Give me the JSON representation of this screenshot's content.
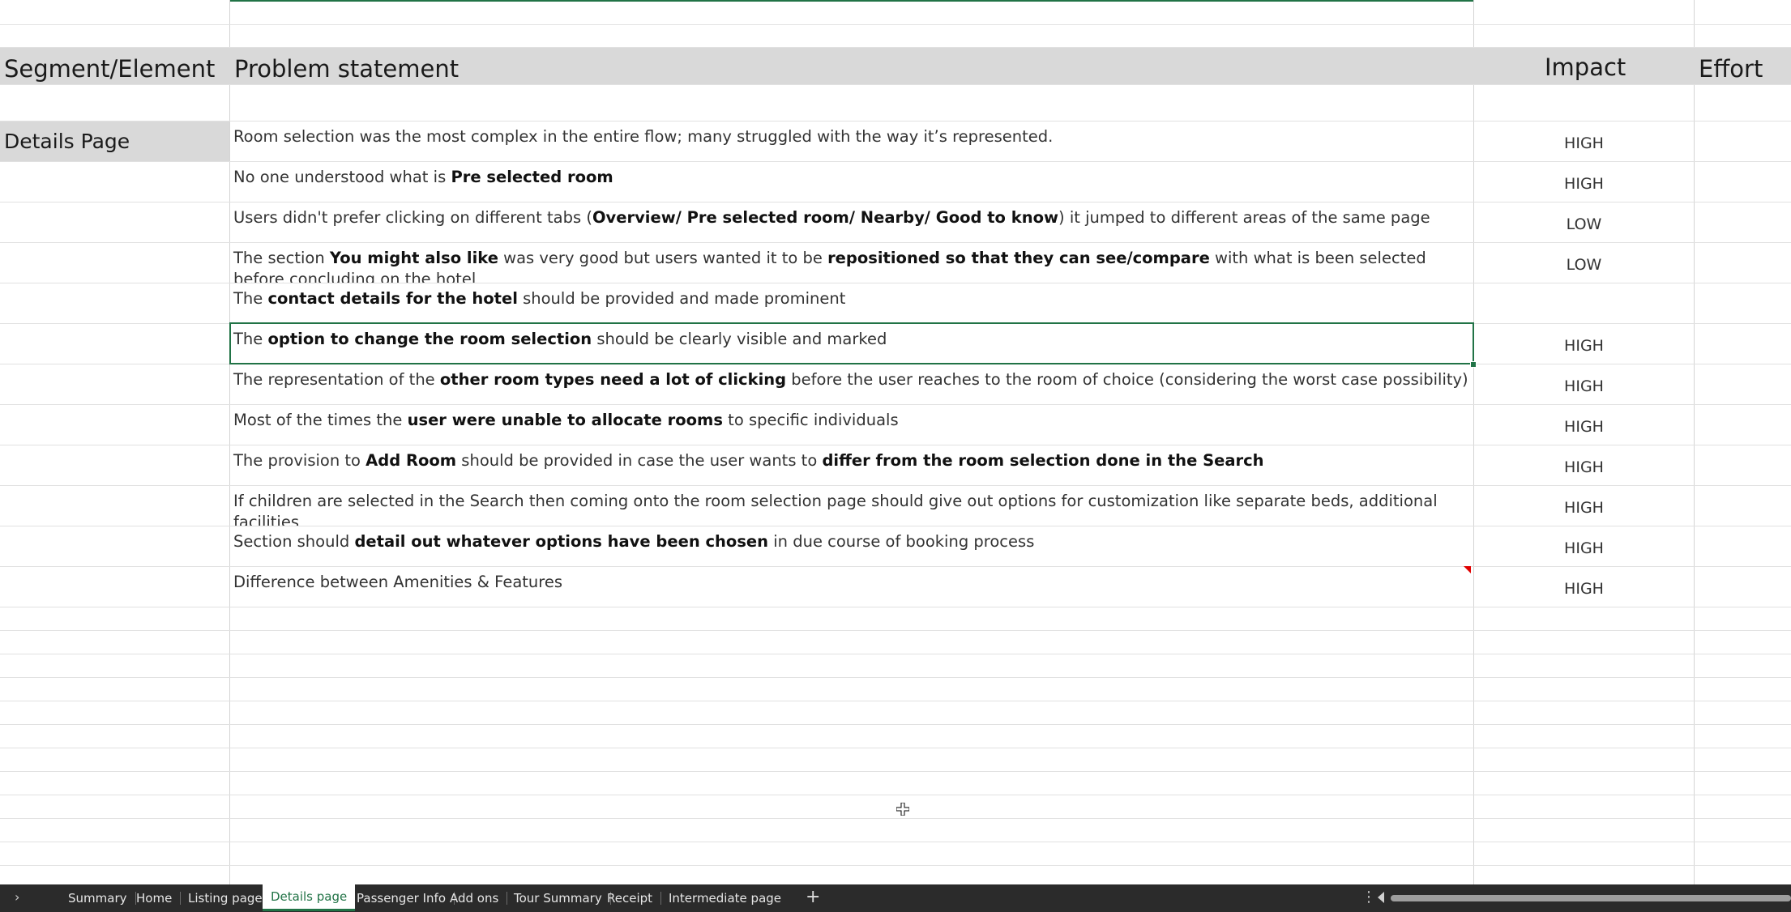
{
  "header": {
    "segment": "Segment/Element",
    "problem": "Problem statement",
    "impact": "Impact",
    "effort": "Effort"
  },
  "segment_label": "Details Page",
  "rows": [
    {
      "parts": [
        {
          "t": "Room selection was the most complex in the entire flow; many struggled with the way it’s represented.",
          "b": false
        }
      ],
      "impact": "HIGH"
    },
    {
      "parts": [
        {
          "t": "No one understood  what is ",
          "b": false
        },
        {
          "t": "Pre selected room",
          "b": true
        }
      ],
      "impact": "HIGH"
    },
    {
      "parts": [
        {
          "t": "Users didn't prefer clicking on different tabs (",
          "b": false
        },
        {
          "t": "Overview/ Pre selected room/ Nearby/ Good to know",
          "b": true
        },
        {
          "t": ") it jumped to different areas of the same page",
          "b": false
        }
      ],
      "impact": "LOW"
    },
    {
      "parts": [
        {
          "t": "The section ",
          "b": false
        },
        {
          "t": "You might also like",
          "b": true
        },
        {
          "t": " was very good but users wanted it to be ",
          "b": false
        },
        {
          "t": "repositioned so that they can see/compare",
          "b": true
        },
        {
          "t": " with what is been selected before concluding on the hotel",
          "b": false
        }
      ],
      "impact": "LOW"
    },
    {
      "parts": [
        {
          "t": "The ",
          "b": false
        },
        {
          "t": "contact details for the hotel",
          "b": true
        },
        {
          "t": " should be provided and made prominent",
          "b": false
        }
      ],
      "impact": ""
    },
    {
      "parts": [
        {
          "t": "The ",
          "b": false
        },
        {
          "t": "option to change the room selection",
          "b": true
        },
        {
          "t": " should be clearly visible and marked",
          "b": false
        }
      ],
      "impact": "HIGH"
    },
    {
      "parts": [
        {
          "t": "The representation of the ",
          "b": false
        },
        {
          "t": "other room types need a lot of clicking",
          "b": true
        },
        {
          "t": " before the user reaches to the room of choice (considering the worst case possibility)",
          "b": false
        }
      ],
      "impact": "HIGH"
    },
    {
      "parts": [
        {
          "t": "Most of the times the ",
          "b": false
        },
        {
          "t": "user were unable to allocate rooms",
          "b": true
        },
        {
          "t": " to specific individuals",
          "b": false
        }
      ],
      "impact": "HIGH"
    },
    {
      "parts": [
        {
          "t": "The provision to ",
          "b": false
        },
        {
          "t": "Add Room",
          "b": true
        },
        {
          "t": " should be provided in case the user wants to ",
          "b": false
        },
        {
          "t": "differ from the room selection done in the Search",
          "b": true
        }
      ],
      "impact": "HIGH"
    },
    {
      "parts": [
        {
          "t": "If children are selected in the Search then coming onto the room selection page should give out options for customization like separate beds, additional facilities",
          "b": false
        }
      ],
      "impact": "HIGH"
    },
    {
      "parts": [
        {
          "t": "Section should ",
          "b": false
        },
        {
          "t": "detail out whatever options have been chosen",
          "b": true
        },
        {
          "t": " in due course of booking process",
          "b": false
        }
      ],
      "impact": "HIGH"
    },
    {
      "parts": [
        {
          "t": "Difference between Amenities & Features",
          "b": false
        }
      ],
      "impact": "HIGH"
    }
  ],
  "tabs": [
    "Summary",
    "Home",
    "Listing page",
    "Details page",
    "Passenger Info",
    "Add ons",
    "Tour Summary",
    "Receipt",
    "Intermediate page"
  ],
  "active_tab": "Details page",
  "tabbar": {
    "nav": "›",
    "add": "+",
    "more": "⋮"
  },
  "colors": {
    "accent": "#217346",
    "header_fill": "#d9d9d9",
    "tabbar_bg": "#2b2b2b"
  }
}
